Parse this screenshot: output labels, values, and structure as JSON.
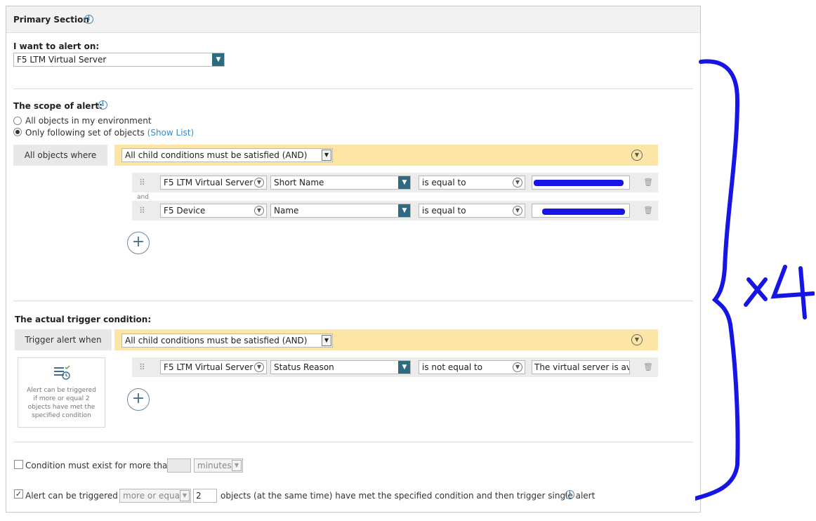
{
  "primary": {
    "title": "Primary Section",
    "alert_on_label": "I want to alert on:",
    "alert_on_value": "F5 LTM Virtual Server"
  },
  "scope": {
    "label": "The scope of alert:",
    "radio_all": "All objects in my environment",
    "radio_following": "Only following set of objects",
    "show_list": "(Show List)",
    "where_label": "All objects where",
    "logic_value": "All child conditions must be satisfied (AND)",
    "and_label": "and",
    "conditions": [
      {
        "object": "F5 LTM Virtual Server",
        "property": "Short Name",
        "operator": "is equal to",
        "value": ""
      },
      {
        "object": "F5 Device",
        "property": "Name",
        "operator": "is equal to",
        "value": ""
      }
    ]
  },
  "trigger": {
    "label": "The actual trigger condition:",
    "when_label": "Trigger alert when",
    "logic_value": "All child conditions must be satisfied (AND)",
    "conditions": [
      {
        "object": "F5 LTM Virtual Server",
        "property": "Status Reason",
        "operator": "is not equal to",
        "value": "The virtual server is availa"
      }
    ],
    "card_text": "Alert can be triggered if more or equal 2 objects have met the specified condition"
  },
  "options": {
    "exist_label": "Condition must exist for more than",
    "exist_value": "",
    "exist_unit": "minutes",
    "triggered_label": "Alert can be triggered if",
    "triggered_mode": "more or equal",
    "triggered_count": "2",
    "triggered_suffix": "objects (at the same time) have met the specified condition and then trigger single alert"
  },
  "annotation": {
    "text": "x 4"
  },
  "colors": {
    "accent_teal": "#2f6b80",
    "yellow_bar": "#fde6a5",
    "annotation_blue": "#1515e6",
    "link_blue": "#3b88c4"
  }
}
